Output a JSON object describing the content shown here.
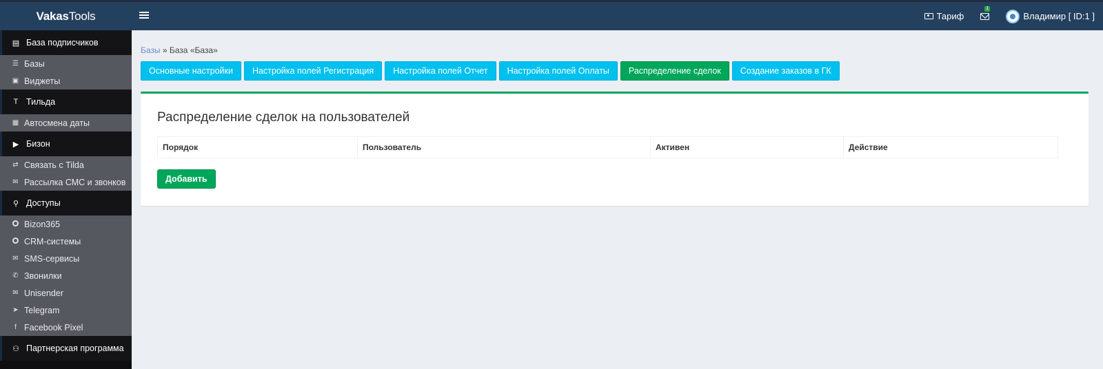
{
  "app": {
    "logo_bold": "Vakas",
    "logo_rest": "Tools"
  },
  "topbar": {
    "tariff_label": "Тариф",
    "mail_badge": "1",
    "user_label": "Владимир [ ID:1 ]"
  },
  "sidebar": {
    "sections": [
      {
        "title": "База подписчиков",
        "icon": "table-icon",
        "items": [
          {
            "label": "Базы",
            "icon": "database-icon"
          },
          {
            "label": "Виджеты",
            "icon": "widget-icon"
          }
        ]
      },
      {
        "title": "Тильда",
        "icon": "text-icon",
        "items": [
          {
            "label": "Автосмена даты",
            "icon": "calendar-icon"
          }
        ]
      },
      {
        "title": "Бизон",
        "icon": "youtube-icon",
        "items": [
          {
            "label": "Связать с Tilda",
            "icon": "exchange-icon"
          },
          {
            "label": "Рассылка СМС и звонков",
            "icon": "envelope-icon"
          }
        ]
      },
      {
        "title": "Доступы",
        "icon": "key-icon",
        "items": [
          {
            "label": "Bizon365",
            "icon": "circle-icon"
          },
          {
            "label": "CRM-системы",
            "icon": "circle-icon"
          },
          {
            "label": "SMS-сервисы",
            "icon": "envelope-icon"
          },
          {
            "label": "Звонилки",
            "icon": "phone-icon"
          },
          {
            "label": "Unisender",
            "icon": "envelope-filled-icon"
          },
          {
            "label": "Telegram",
            "icon": "paper-plane-icon"
          },
          {
            "label": "Facebook Pixel",
            "icon": "facebook-icon"
          }
        ]
      },
      {
        "title": "Партнерская программа",
        "icon": "users-icon",
        "items": []
      }
    ]
  },
  "breadcrumb": {
    "link": "Базы",
    "separator": " » ",
    "current": "База «База»"
  },
  "tabs": [
    {
      "label": "Основные настройки",
      "active": false
    },
    {
      "label": "Настройка полей Регистрация",
      "active": false
    },
    {
      "label": "Настройка полей Отчет",
      "active": false
    },
    {
      "label": "Настройка полей Оплаты",
      "active": false
    },
    {
      "label": "Распределение сделок",
      "active": true
    },
    {
      "label": "Создание заказов в ГК",
      "active": false
    }
  ],
  "card": {
    "title": "Распределение сделок на пользователей",
    "columns": [
      "Порядок",
      "Пользователь",
      "Активен",
      "Действие"
    ],
    "add_button": "Добавить"
  },
  "colors": {
    "topbar": "#24405f",
    "tab_default": "#00c0ef",
    "tab_active": "#00a65a",
    "button_success": "#00a65a"
  }
}
